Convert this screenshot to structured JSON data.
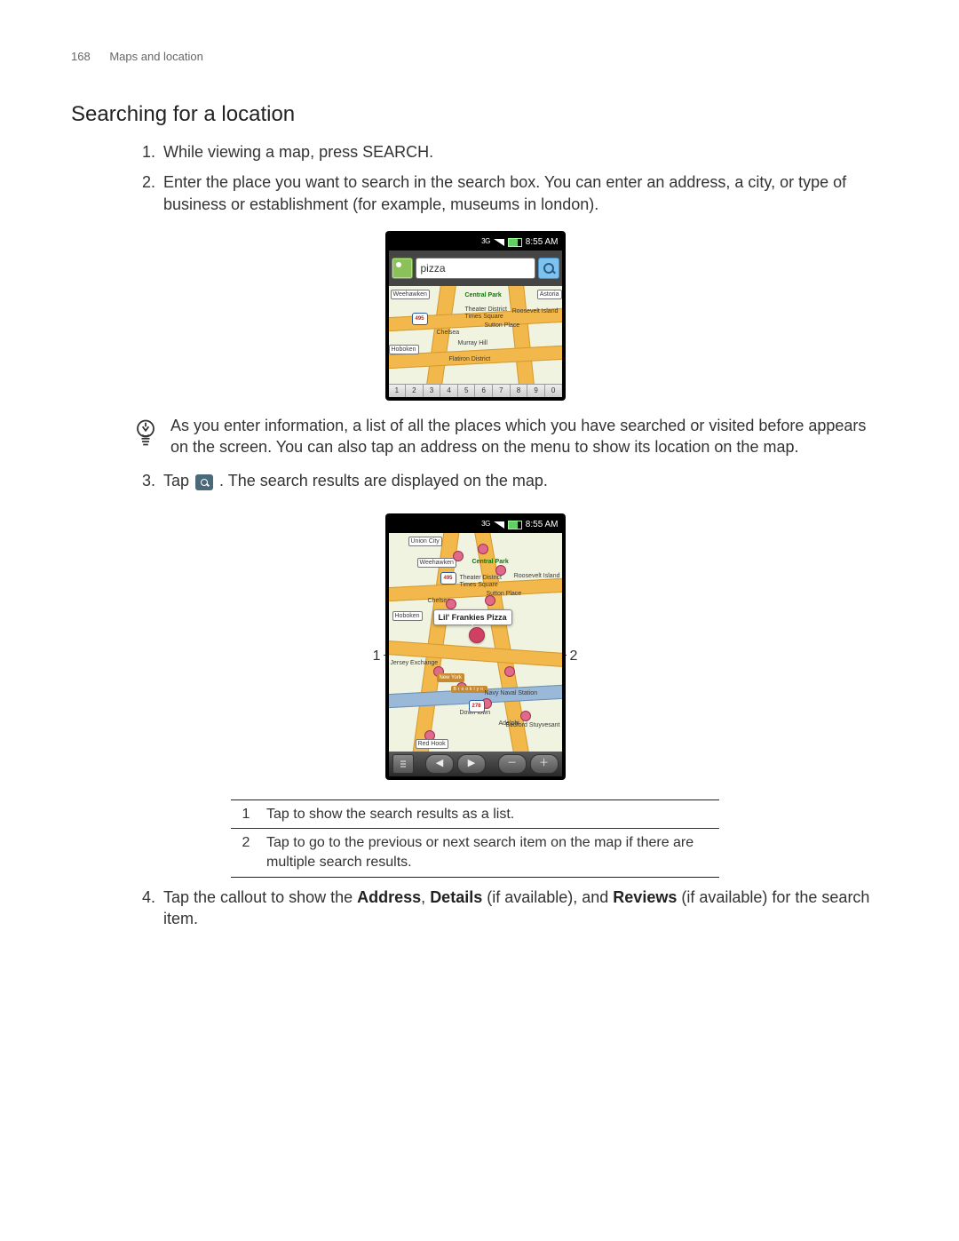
{
  "page": {
    "number": "168",
    "section": "Maps and location"
  },
  "heading": "Searching for a location",
  "steps": {
    "s1": "While viewing a map, press SEARCH.",
    "s2": "Enter the place you want to search in the search box. You can enter an address, a city, or type of business or establishment (for example, museums in london).",
    "s3_a": "Tap ",
    "s3_b": " . The search results are displayed on the map.",
    "s4_a": "Tap the callout to show the ",
    "s4_address": "Address",
    "s4_b": ", ",
    "s4_details": "Details",
    "s4_c": " (if available), and ",
    "s4_reviews": "Reviews",
    "s4_d": " (if available) for the search item."
  },
  "tip": "As you enter information, a list of all the places which you have searched or visited before appears on the screen. You can also tap an address on the menu to show its location on the map.",
  "fig1": {
    "status_time": "8:55 AM",
    "status_net": "3G",
    "search_value": "pizza",
    "labels": {
      "weehawken": "Weehawken",
      "centralpark": "Central Park",
      "theater": "Theater District",
      "timessq": "Times Square",
      "roosevelt": "Roosevelt Island",
      "chelsea": "Chelsea",
      "suttonpl": "Sutton Place",
      "murray": "Murray Hill",
      "flatiron": "Flatiron District",
      "hoboken": "Hoboken",
      "astoria": "Astoria",
      "r495": "495"
    },
    "keys": [
      "1",
      "2",
      "3",
      "4",
      "5",
      "6",
      "7",
      "8",
      "9",
      "0"
    ]
  },
  "fig2": {
    "status_time": "8:55 AM",
    "status_net": "3G",
    "callout": "Lil' Frankies Pizza",
    "labels": {
      "unionc": "Union City",
      "weehawken": "Weehawken",
      "centralpark": "Central Park",
      "theater": "Theater District",
      "timessq": "Times Square",
      "roosevelt": "Roosevelt Island",
      "chelsea": "Chelsea",
      "suttonpl": "Sutton Place",
      "hoboken": "Hoboken",
      "newyork": "New York",
      "brooklyn": "Brooklyn",
      "downtown": "Down town",
      "navalst": "Navy Naval Station",
      "adelphi": "Adelphi",
      "bedford": "Bedford Stuyvesant",
      "redhook": "Red Hook",
      "r495": "495",
      "r278": "278",
      "jxchange": "Jersey Exchange"
    },
    "label_left": "1",
    "label_right": "2"
  },
  "legend": {
    "r1_num": "1",
    "r1_txt": "Tap to show the search results as a list.",
    "r2_num": "2",
    "r2_txt": "Tap to go to the previous or next search item on the map if there are multiple search results."
  }
}
